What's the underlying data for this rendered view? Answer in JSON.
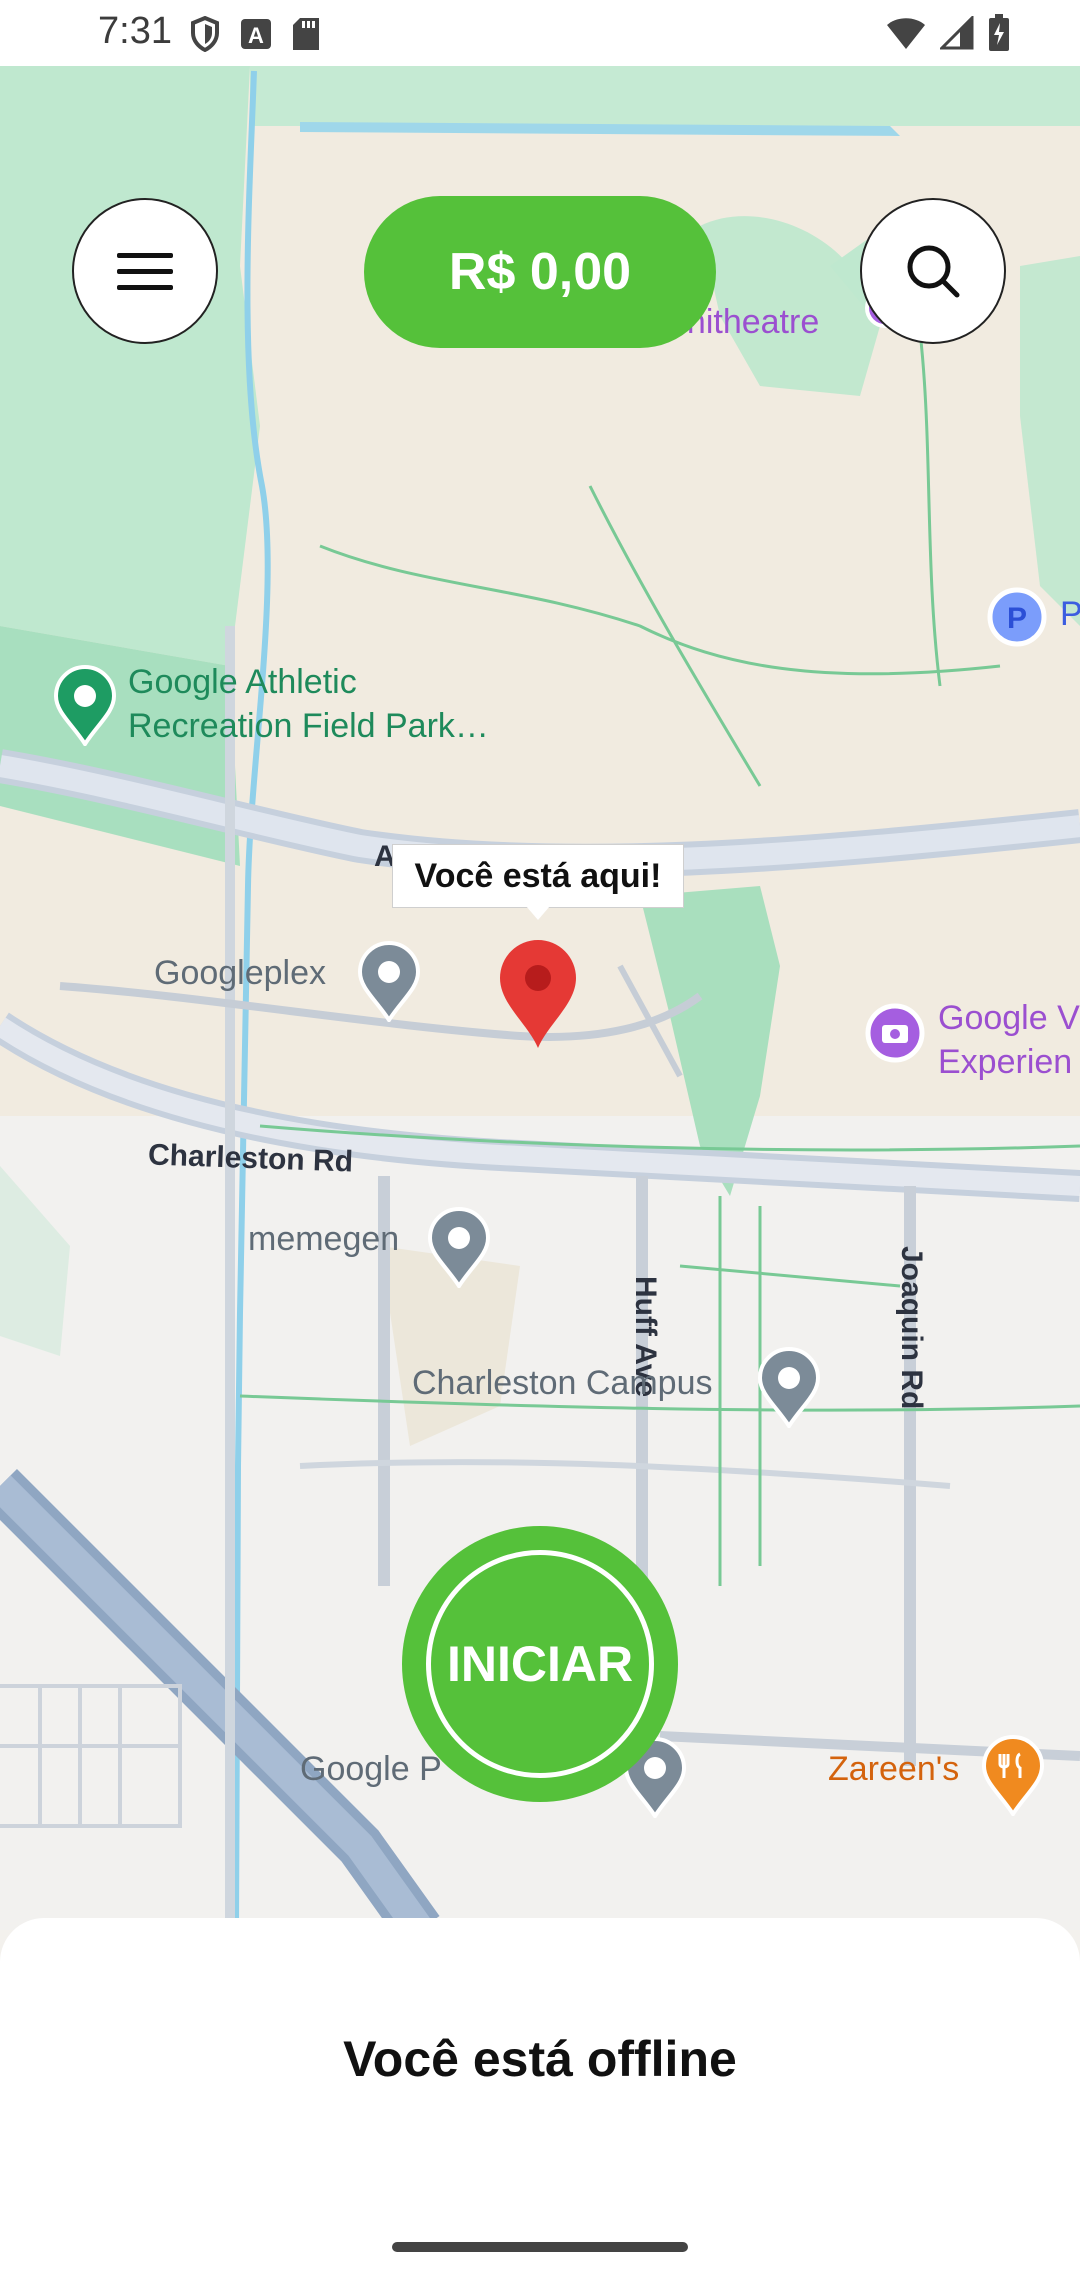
{
  "status_bar": {
    "time": "7:31",
    "left_icons": [
      "shield-icon",
      "a-badge-icon",
      "sd-card-icon"
    ],
    "right_icons": [
      "wifi-icon",
      "signal-icon",
      "battery-icon"
    ]
  },
  "header": {
    "menu_icon": "hamburger-icon",
    "balance": "R$ 0,00",
    "search_icon": "search-icon",
    "accent_color": "#55c13a"
  },
  "map": {
    "labels": {
      "amphitheatre": "phitheatre",
      "parking_partial": "P",
      "google_athletic": "Google Athletic",
      "recreation_field": "Recreation Field Park…",
      "road_a": "A",
      "googleplex": "Googleplex",
      "google_v": "Google V",
      "experien": "Experien",
      "charleston_rd": "Charleston Rd",
      "memegen": "memegen",
      "huff_ave": "Huff Ave",
      "joaquin_rd": "Joaquin Rd",
      "charleston_campus": "Charleston Campus",
      "google_p": "Google P",
      "zareens": "Zareen's"
    },
    "you_are_here": "Você está aqui!"
  },
  "start_button": "INICIAR",
  "bottom_sheet": {
    "status": "Você está offline"
  }
}
